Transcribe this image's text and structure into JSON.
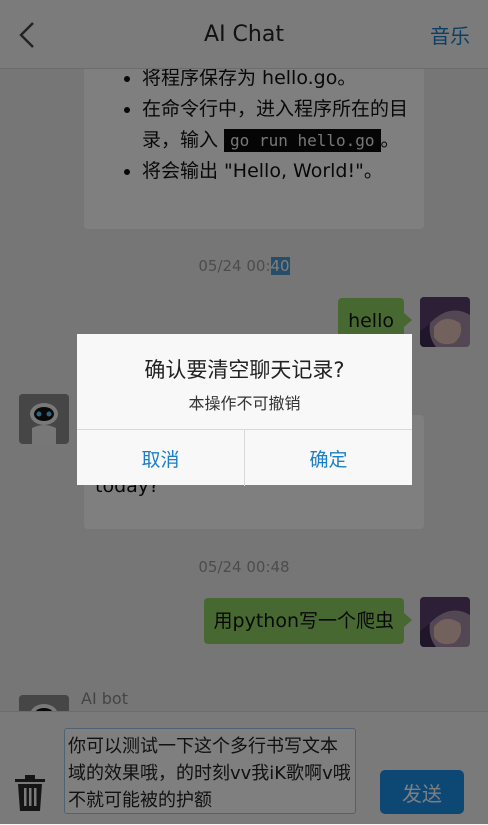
{
  "header": {
    "title": "AI Chat",
    "music_label": "音乐"
  },
  "messages": {
    "bot1": {
      "steps": [
        {
          "before": "将程序保存为 hello.go。",
          "code": "",
          "after": ""
        },
        {
          "before": "在命令行中，进入程序所在的目录，输入 ",
          "code": "go run hello.go",
          "after": "。"
        },
        {
          "before": "将会输出 \"Hello, World!\"。",
          "code": "",
          "after": ""
        }
      ]
    },
    "ts1_prefix": "05/24 00:",
    "ts1_highlight": "40",
    "user1": "hello",
    "bot2_tail": "today?",
    "ts2": "05/24 00:48",
    "user2": "用python写一个爬虫",
    "bot3_name": "AI bot"
  },
  "dialog": {
    "title": "确认要清空聊天记录?",
    "message": "本操作不可撤销",
    "cancel_label": "取消",
    "confirm_label": "确定"
  },
  "footer": {
    "input_value": "你可以测试一下这个多行书写文本域的效果哦，的时刻vv我iK歌啊v哦不就可能被的护额",
    "send_label": "发送"
  },
  "colors": {
    "accent": "#1a7fc4",
    "user_bubble": "#8ed160",
    "send_button": "#1a8fe8"
  }
}
